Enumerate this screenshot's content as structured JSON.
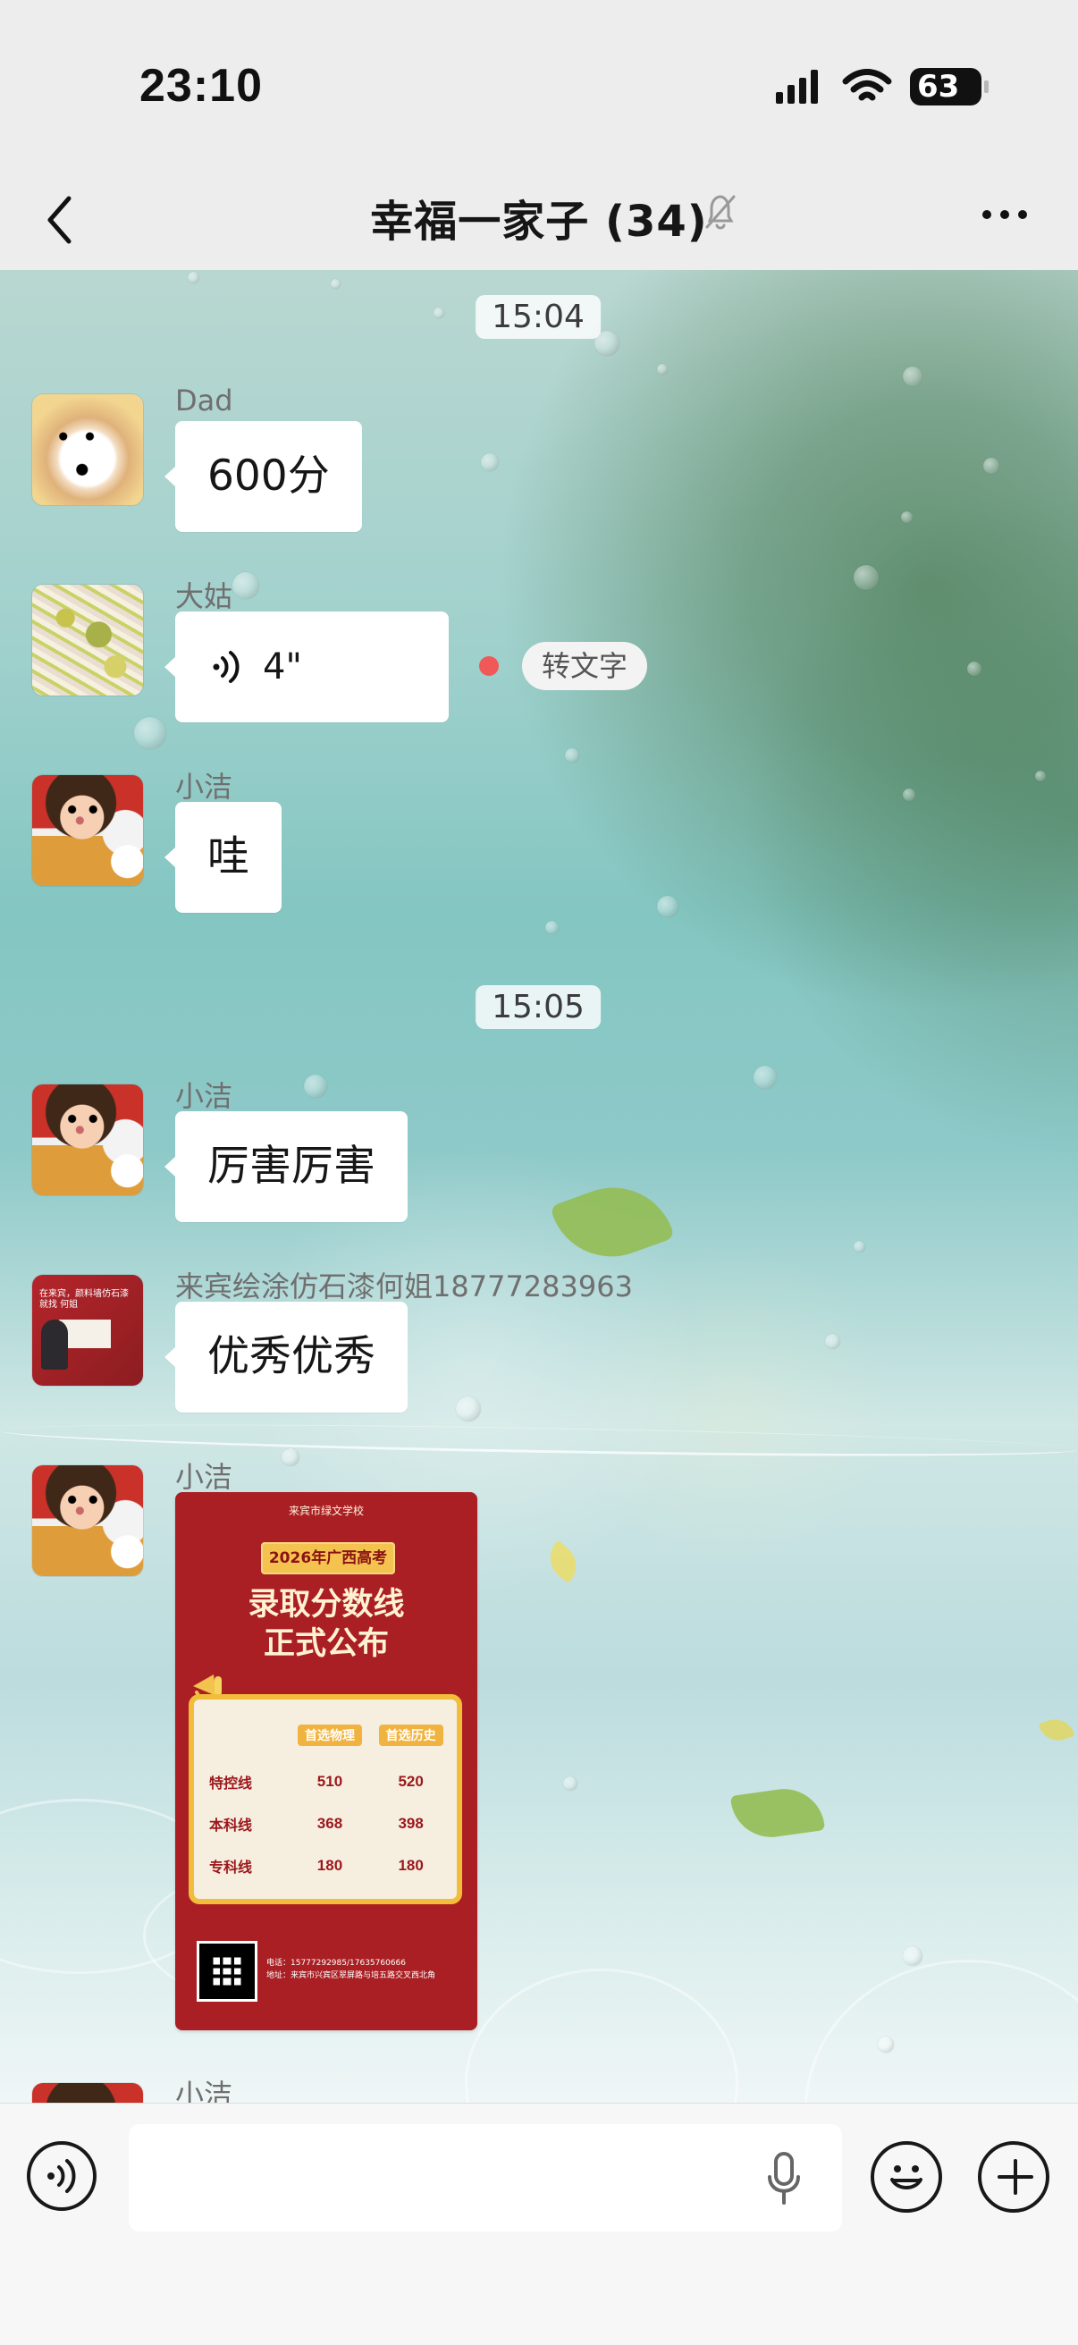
{
  "status_bar": {
    "time": "23:10",
    "battery": "63"
  },
  "header": {
    "chat_title": "幸福一家子 (34)"
  },
  "messages": [
    {
      "type": "timestamp",
      "text": "15:04"
    },
    {
      "sender": "Dad",
      "text": "600分",
      "avatar": "dog-avatar"
    },
    {
      "sender": "大姑",
      "voice_duration": "4\"",
      "transcribe_label": "转文字",
      "avatar": "sprouts-avatar"
    },
    {
      "sender": "小洁",
      "text": "哇",
      "avatar": "woman-avatar"
    },
    {
      "type": "timestamp",
      "text": "15:05"
    },
    {
      "sender": "小洁",
      "text": "厉害厉害",
      "avatar": "woman-avatar"
    },
    {
      "sender": "来宾绘涂仿石漆何姐18777283963",
      "text": "优秀优秀",
      "avatar": "painter-ad-avatar"
    },
    {
      "sender": "小洁",
      "avatar": "woman-avatar",
      "poster": {
        "school": "来宾市绿文学校",
        "tag": "2026年广西高考",
        "title_line1": "录取分数线",
        "title_line2": "正式公布",
        "columns": [
          "首选物理",
          "首选历史"
        ],
        "rows": [
          {
            "label": "特控线",
            "physics": "510",
            "history": "520"
          },
          {
            "label": "本科线",
            "physics": "368",
            "history": "398"
          },
          {
            "label": "专科线",
            "physics": "180",
            "history": "180"
          }
        ],
        "contact_phone": "电话：15777292985/17635760666",
        "contact_address": "地址：来宾市兴宾区翠屏路与培五路交叉西北角"
      }
    },
    {
      "sender": "小洁",
      "avatar": "woman-avatar"
    }
  ],
  "icons": {
    "signal": "signal-bars-icon",
    "wifi": "wifi-icon",
    "back": "chevron-left-icon",
    "mute": "muted-bell-icon",
    "more": "more-icon",
    "voice": "voice-icon",
    "mic": "microphone-icon",
    "emoji": "emoji-icon",
    "plus": "plus-icon"
  },
  "colors": {
    "unread_dot": "#f15858",
    "poster_red": "#aa1f23",
    "poster_gold": "#f1bd3b"
  }
}
